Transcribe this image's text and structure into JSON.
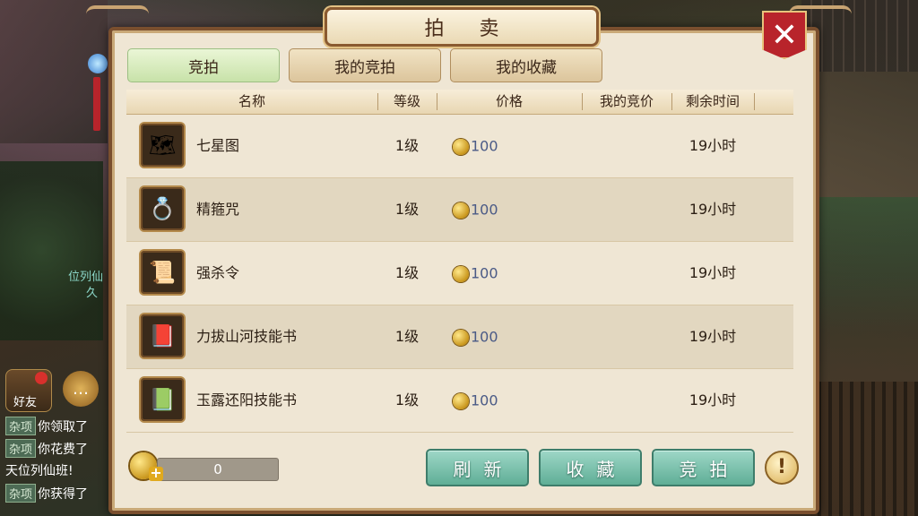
{
  "hud": {
    "friend_label": "好友",
    "side_text_1": "位列仙",
    "side_text_2": "久",
    "chat": [
      {
        "tag": "杂项",
        "text": "你领取了"
      },
      {
        "tag": "杂项",
        "text": "你花费了"
      },
      {
        "tag": "",
        "text": "天位列仙班!"
      },
      {
        "tag": "杂项",
        "text": "你获得了"
      }
    ]
  },
  "window": {
    "title": "拍 卖",
    "close_symbol": "✕"
  },
  "tabs": [
    {
      "label": "竞拍",
      "active": true
    },
    {
      "label": "我的竞拍",
      "active": false
    },
    {
      "label": "我的收藏",
      "active": false
    }
  ],
  "table": {
    "headers": [
      "名称",
      "等级",
      "价格",
      "我的竞价",
      "剩余时间"
    ],
    "rows": [
      {
        "icon": "treasure-map-icon",
        "glyph": "🗺",
        "name": "七星图",
        "level": "1级",
        "price": "100",
        "my_bid": "",
        "time_left": "19小时"
      },
      {
        "icon": "golden-ring-icon",
        "glyph": "💍",
        "name": "精箍咒",
        "level": "1级",
        "price": "100",
        "my_bid": "",
        "time_left": "19小时"
      },
      {
        "icon": "kill-order-scroll-icon",
        "glyph": "📜",
        "name": "强杀令",
        "level": "1级",
        "price": "100",
        "my_bid": "",
        "time_left": "19小时"
      },
      {
        "icon": "skill-book-scroll-icon",
        "glyph": "📕",
        "name": "力拔山河技能书",
        "level": "1级",
        "price": "100",
        "my_bid": "",
        "time_left": "19小时"
      },
      {
        "icon": "green-skill-book-icon",
        "glyph": "📗",
        "name": "玉露还阳技能书",
        "level": "1级",
        "price": "100",
        "my_bid": "",
        "time_left": "19小时"
      }
    ]
  },
  "footer": {
    "gold_amount": "0",
    "refresh_label": "刷新",
    "favorite_label": "收藏",
    "bid_label": "竞拍",
    "info_symbol": "!"
  },
  "colors": {
    "panel_bg": "#efe6d4",
    "accent_green": "#5fae96",
    "close_red": "#b8242b",
    "price_text": "#4a5a86"
  }
}
